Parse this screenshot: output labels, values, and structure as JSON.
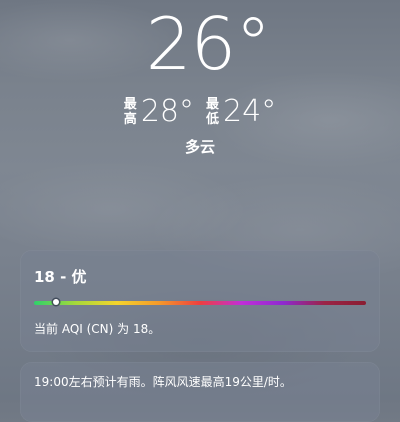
{
  "current": {
    "temperature": "26°",
    "high_label_top": "最",
    "high_label_bottom": "高",
    "high": "28°",
    "low_label_top": "最",
    "low_label_bottom": "低",
    "low": "24°",
    "condition": "多云"
  },
  "aqi": {
    "title": "18 - 优",
    "value": 18,
    "scale_max": 500,
    "description": "当前 AQI (CN) 为 18。",
    "gradient_colors": [
      "#2fd26a",
      "#a6d93a",
      "#f5d42c",
      "#f59a2a",
      "#ef3f3f",
      "#c12fd8",
      "#8e2ad0",
      "#9b2446",
      "#8a1e32"
    ]
  },
  "forecast_note": {
    "text": "19:00左右预计有雨。阵风风速最高19公里/时。"
  }
}
